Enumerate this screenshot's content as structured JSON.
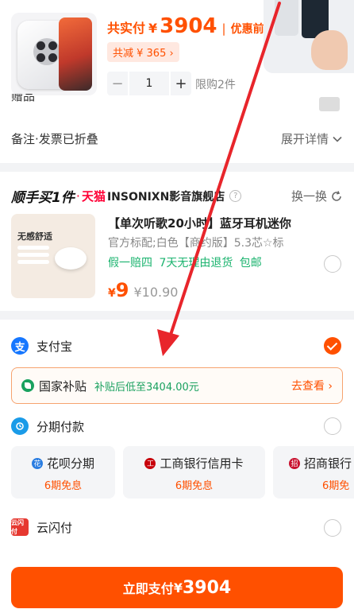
{
  "order": {
    "total_label": "共实付",
    "currency": "¥",
    "total_amount": "3904",
    "separator": "|",
    "discount_label": "优惠前",
    "reduce_badge": "共减 ¥ 365 ›",
    "minus": "−",
    "quantity": "1",
    "plus": "+",
    "limit_text": "限购2件",
    "gift_text": "赠品",
    "remark_label": "备注·发票已折叠",
    "expand_label": "展开详情"
  },
  "addon": {
    "brand_text": "顺手买1件",
    "dot": "·",
    "tmall": "天猫",
    "shop_name": "INSONIXN影音旗舰店",
    "help_mark": "?",
    "swap_label": "换一换",
    "image_caption": "无感舒适",
    "title": "【单次听歌20小时】蓝牙耳机迷你",
    "subtitle": "官方标配;白色【商约版】5.3芯☆标",
    "tags": "假一赔四 7天无理由退货 包邮",
    "currency": "¥",
    "price": "9",
    "original_price": "¥10.90"
  },
  "payment": {
    "alipay_label": "支付宝",
    "alipay_icon_glyph": "支",
    "subsidy_name": "国家补贴",
    "subsidy_desc": "补贴后低至3404.00元",
    "subsidy_link": "去查看 ›",
    "fenqi_label": "分期付款",
    "plans": [
      {
        "name": "花呗分期",
        "free": "6期免息",
        "glyph": "花",
        "color": "#2a7de1"
      },
      {
        "name": "工商银行信用卡",
        "free": "6期免息",
        "glyph": "工",
        "color": "#c7000b"
      },
      {
        "name": "招商银行",
        "free": "6期免",
        "glyph": "招",
        "color": "#c8102e"
      }
    ],
    "ysf_label": "云闪付",
    "ysf_glyph": "云闪付",
    "pay_button_label": "立即支付",
    "pay_button_currency": "¥",
    "pay_button_amount": "3904"
  },
  "colors": {
    "accent": "#ff5000",
    "annotation_arrow": "#e8252b"
  }
}
